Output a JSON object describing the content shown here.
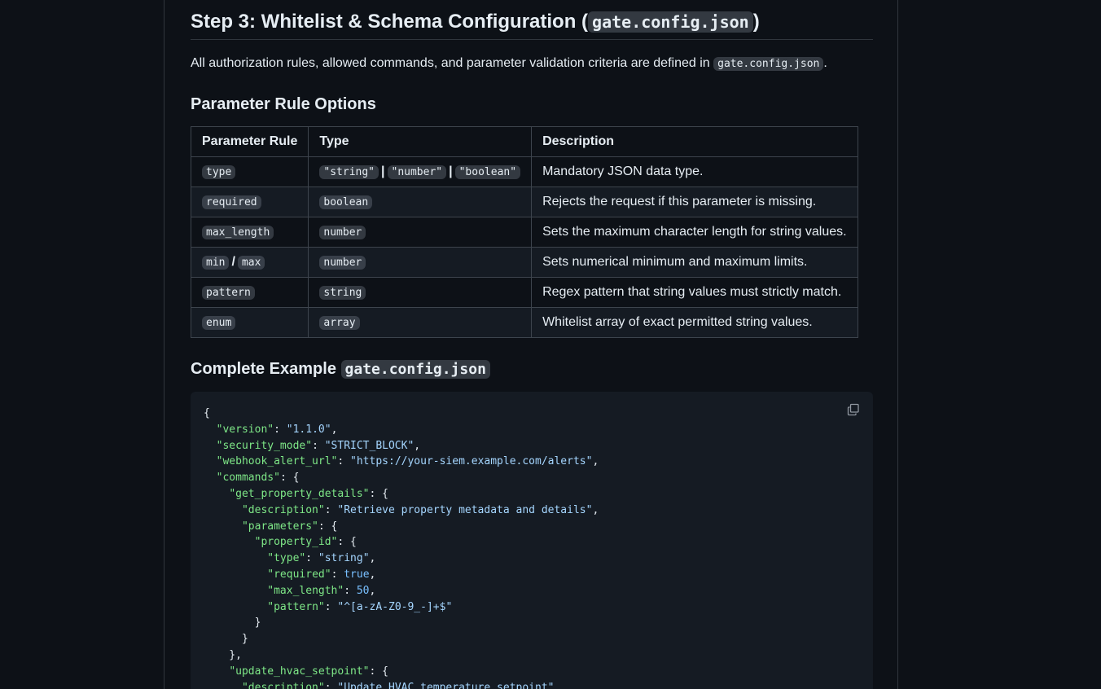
{
  "step": {
    "title_prefix": "Step 3: Whitelist & Schema Configuration (",
    "title_code": "gate.config.json",
    "title_suffix": ")"
  },
  "intro": {
    "text": "All authorization rules, allowed commands, and parameter validation criteria are defined in",
    "code": "gate.config.json",
    "suffix": "."
  },
  "rules_heading": "Parameter Rule Options",
  "table": {
    "headers": [
      "Parameter Rule",
      "Type",
      "Description"
    ],
    "rows": [
      {
        "rule": "type",
        "types": [
          "\"string\"",
          "\"number\"",
          "\"boolean\""
        ],
        "desc": "Mandatory JSON data type."
      },
      {
        "rule": "required",
        "types": [
          "boolean"
        ],
        "desc": "Rejects the request if this parameter is missing."
      },
      {
        "rule": "max_length",
        "types": [
          "number"
        ],
        "desc": "Sets the maximum character length for string values."
      },
      {
        "rule_a": "min",
        "rule_b": "max",
        "types": [
          "number"
        ],
        "desc": "Sets numerical minimum and maximum limits."
      },
      {
        "rule": "pattern",
        "types": [
          "string"
        ],
        "desc": "Regex pattern that string values must strictly match."
      },
      {
        "rule": "enum",
        "types": [
          "array"
        ],
        "desc": "Whitelist array of exact permitted string values."
      }
    ],
    "sep": "|",
    "slash": "/"
  },
  "example_heading": {
    "prefix": "Complete Example",
    "code": "gate.config.json"
  },
  "code": {
    "version_key": "\"version\"",
    "version_val": "\"1.1.0\"",
    "security_key": "\"security_mode\"",
    "security_val": "\"STRICT_BLOCK\"",
    "webhook_key": "\"webhook_alert_url\"",
    "webhook_val": "\"https://your-siem.example.com/alerts\"",
    "commands_key": "\"commands\"",
    "cmd1_key": "\"get_property_details\"",
    "desc_key": "\"description\"",
    "cmd1_desc": "\"Retrieve property metadata and details\"",
    "params_key": "\"parameters\"",
    "prop_key": "\"property_id\"",
    "type_key": "\"type\"",
    "type_val": "\"string\"",
    "required_key": "\"required\"",
    "required_val": "true",
    "maxlen_key": "\"max_length\"",
    "maxlen_val": "50",
    "pattern_key": "\"pattern\"",
    "pattern_val": "\"^[a-zA-Z0-9_-]+$\"",
    "cmd2_key": "\"update_hvac_setpoint\"",
    "cmd2_desc": "\"Update HVAC temperature setpoint\""
  },
  "icons": {
    "copy": "copy-icon"
  },
  "colors": {
    "background": "#0d1117",
    "code_bg": "#151b23",
    "key": "#7ee787",
    "string": "#a5d6ff",
    "number": "#79c0ff"
  }
}
